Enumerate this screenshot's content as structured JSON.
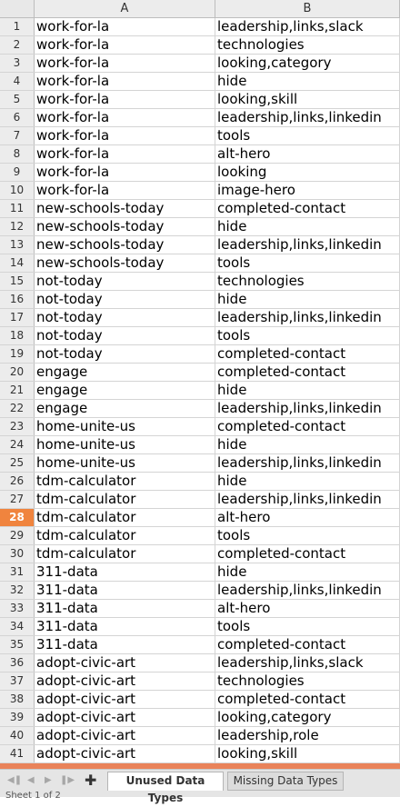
{
  "columns": {
    "a": "A",
    "b": "B"
  },
  "active_row": "28",
  "rows": [
    {
      "n": "1",
      "a": "work-for-la",
      "b": "leadership,links,slack"
    },
    {
      "n": "2",
      "a": "work-for-la",
      "b": "technologies"
    },
    {
      "n": "3",
      "a": "work-for-la",
      "b": "looking,category"
    },
    {
      "n": "4",
      "a": "work-for-la",
      "b": "hide"
    },
    {
      "n": "5",
      "a": "work-for-la",
      "b": "looking,skill"
    },
    {
      "n": "6",
      "a": "work-for-la",
      "b": "leadership,links,linkedin"
    },
    {
      "n": "7",
      "a": "work-for-la",
      "b": "tools"
    },
    {
      "n": "8",
      "a": "work-for-la",
      "b": "alt-hero"
    },
    {
      "n": "9",
      "a": "work-for-la",
      "b": "looking"
    },
    {
      "n": "10",
      "a": "work-for-la",
      "b": "image-hero"
    },
    {
      "n": "11",
      "a": "new-schools-today",
      "b": "completed-contact"
    },
    {
      "n": "12",
      "a": "new-schools-today",
      "b": "hide"
    },
    {
      "n": "13",
      "a": "new-schools-today",
      "b": "leadership,links,linkedin"
    },
    {
      "n": "14",
      "a": "new-schools-today",
      "b": "tools"
    },
    {
      "n": "15",
      "a": "not-today",
      "b": "technologies"
    },
    {
      "n": "16",
      "a": "not-today",
      "b": "hide"
    },
    {
      "n": "17",
      "a": "not-today",
      "b": "leadership,links,linkedin"
    },
    {
      "n": "18",
      "a": "not-today",
      "b": "tools"
    },
    {
      "n": "19",
      "a": "not-today",
      "b": "completed-contact"
    },
    {
      "n": "20",
      "a": "engage",
      "b": "completed-contact"
    },
    {
      "n": "21",
      "a": "engage",
      "b": "hide"
    },
    {
      "n": "22",
      "a": "engage",
      "b": "leadership,links,linkedin"
    },
    {
      "n": "23",
      "a": "home-unite-us",
      "b": "completed-contact"
    },
    {
      "n": "24",
      "a": "home-unite-us",
      "b": "hide"
    },
    {
      "n": "25",
      "a": "home-unite-us",
      "b": "leadership,links,linkedin"
    },
    {
      "n": "26",
      "a": "tdm-calculator",
      "b": "hide"
    },
    {
      "n": "27",
      "a": "tdm-calculator",
      "b": "leadership,links,linkedin"
    },
    {
      "n": "28",
      "a": "tdm-calculator",
      "b": "alt-hero"
    },
    {
      "n": "29",
      "a": "tdm-calculator",
      "b": "tools"
    },
    {
      "n": "30",
      "a": "tdm-calculator",
      "b": "completed-contact"
    },
    {
      "n": "31",
      "a": "311-data",
      "b": "hide"
    },
    {
      "n": "32",
      "a": "311-data",
      "b": "leadership,links,linkedin"
    },
    {
      "n": "33",
      "a": "311-data",
      "b": "alt-hero"
    },
    {
      "n": "34",
      "a": "311-data",
      "b": "tools"
    },
    {
      "n": "35",
      "a": "311-data",
      "b": "completed-contact"
    },
    {
      "n": "36",
      "a": "adopt-civic-art",
      "b": "leadership,links,slack"
    },
    {
      "n": "37",
      "a": "adopt-civic-art",
      "b": "technologies"
    },
    {
      "n": "38",
      "a": "adopt-civic-art",
      "b": "completed-contact"
    },
    {
      "n": "39",
      "a": "adopt-civic-art",
      "b": "looking,category"
    },
    {
      "n": "40",
      "a": "adopt-civic-art",
      "b": "leadership,role"
    },
    {
      "n": "41",
      "a": "adopt-civic-art",
      "b": "looking,skill"
    }
  ],
  "tabs": {
    "active": "Unused Data Types",
    "inactive": "Missing Data Types"
  },
  "status": "Sheet 1 of 2",
  "icons": {
    "first": "first-sheet-icon",
    "prev": "prev-sheet-icon",
    "next": "next-sheet-icon",
    "last": "last-sheet-icon",
    "add": "add-sheet-icon"
  },
  "colors": {
    "active_row_header": "#f0843e",
    "tab_separator": "#e9835a"
  }
}
